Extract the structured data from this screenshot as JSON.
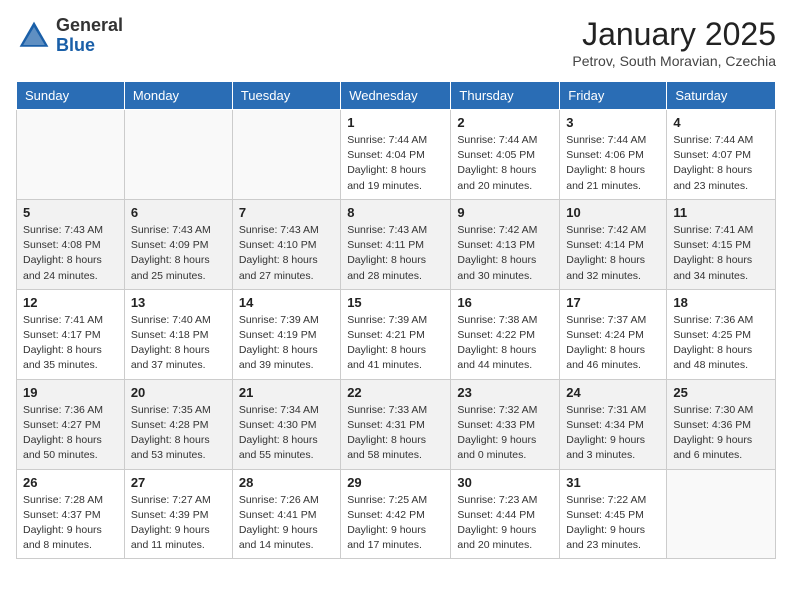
{
  "header": {
    "logo_general": "General",
    "logo_blue": "Blue",
    "month_year": "January 2025",
    "location": "Petrov, South Moravian, Czechia"
  },
  "days_of_week": [
    "Sunday",
    "Monday",
    "Tuesday",
    "Wednesday",
    "Thursday",
    "Friday",
    "Saturday"
  ],
  "weeks": [
    [
      {
        "day": "",
        "info": ""
      },
      {
        "day": "",
        "info": ""
      },
      {
        "day": "",
        "info": ""
      },
      {
        "day": "1",
        "info": "Sunrise: 7:44 AM\nSunset: 4:04 PM\nDaylight: 8 hours\nand 19 minutes."
      },
      {
        "day": "2",
        "info": "Sunrise: 7:44 AM\nSunset: 4:05 PM\nDaylight: 8 hours\nand 20 minutes."
      },
      {
        "day": "3",
        "info": "Sunrise: 7:44 AM\nSunset: 4:06 PM\nDaylight: 8 hours\nand 21 minutes."
      },
      {
        "day": "4",
        "info": "Sunrise: 7:44 AM\nSunset: 4:07 PM\nDaylight: 8 hours\nand 23 minutes."
      }
    ],
    [
      {
        "day": "5",
        "info": "Sunrise: 7:43 AM\nSunset: 4:08 PM\nDaylight: 8 hours\nand 24 minutes."
      },
      {
        "day": "6",
        "info": "Sunrise: 7:43 AM\nSunset: 4:09 PM\nDaylight: 8 hours\nand 25 minutes."
      },
      {
        "day": "7",
        "info": "Sunrise: 7:43 AM\nSunset: 4:10 PM\nDaylight: 8 hours\nand 27 minutes."
      },
      {
        "day": "8",
        "info": "Sunrise: 7:43 AM\nSunset: 4:11 PM\nDaylight: 8 hours\nand 28 minutes."
      },
      {
        "day": "9",
        "info": "Sunrise: 7:42 AM\nSunset: 4:13 PM\nDaylight: 8 hours\nand 30 minutes."
      },
      {
        "day": "10",
        "info": "Sunrise: 7:42 AM\nSunset: 4:14 PM\nDaylight: 8 hours\nand 32 minutes."
      },
      {
        "day": "11",
        "info": "Sunrise: 7:41 AM\nSunset: 4:15 PM\nDaylight: 8 hours\nand 34 minutes."
      }
    ],
    [
      {
        "day": "12",
        "info": "Sunrise: 7:41 AM\nSunset: 4:17 PM\nDaylight: 8 hours\nand 35 minutes."
      },
      {
        "day": "13",
        "info": "Sunrise: 7:40 AM\nSunset: 4:18 PM\nDaylight: 8 hours\nand 37 minutes."
      },
      {
        "day": "14",
        "info": "Sunrise: 7:39 AM\nSunset: 4:19 PM\nDaylight: 8 hours\nand 39 minutes."
      },
      {
        "day": "15",
        "info": "Sunrise: 7:39 AM\nSunset: 4:21 PM\nDaylight: 8 hours\nand 41 minutes."
      },
      {
        "day": "16",
        "info": "Sunrise: 7:38 AM\nSunset: 4:22 PM\nDaylight: 8 hours\nand 44 minutes."
      },
      {
        "day": "17",
        "info": "Sunrise: 7:37 AM\nSunset: 4:24 PM\nDaylight: 8 hours\nand 46 minutes."
      },
      {
        "day": "18",
        "info": "Sunrise: 7:36 AM\nSunset: 4:25 PM\nDaylight: 8 hours\nand 48 minutes."
      }
    ],
    [
      {
        "day": "19",
        "info": "Sunrise: 7:36 AM\nSunset: 4:27 PM\nDaylight: 8 hours\nand 50 minutes."
      },
      {
        "day": "20",
        "info": "Sunrise: 7:35 AM\nSunset: 4:28 PM\nDaylight: 8 hours\nand 53 minutes."
      },
      {
        "day": "21",
        "info": "Sunrise: 7:34 AM\nSunset: 4:30 PM\nDaylight: 8 hours\nand 55 minutes."
      },
      {
        "day": "22",
        "info": "Sunrise: 7:33 AM\nSunset: 4:31 PM\nDaylight: 8 hours\nand 58 minutes."
      },
      {
        "day": "23",
        "info": "Sunrise: 7:32 AM\nSunset: 4:33 PM\nDaylight: 9 hours\nand 0 minutes."
      },
      {
        "day": "24",
        "info": "Sunrise: 7:31 AM\nSunset: 4:34 PM\nDaylight: 9 hours\nand 3 minutes."
      },
      {
        "day": "25",
        "info": "Sunrise: 7:30 AM\nSunset: 4:36 PM\nDaylight: 9 hours\nand 6 minutes."
      }
    ],
    [
      {
        "day": "26",
        "info": "Sunrise: 7:28 AM\nSunset: 4:37 PM\nDaylight: 9 hours\nand 8 minutes."
      },
      {
        "day": "27",
        "info": "Sunrise: 7:27 AM\nSunset: 4:39 PM\nDaylight: 9 hours\nand 11 minutes."
      },
      {
        "day": "28",
        "info": "Sunrise: 7:26 AM\nSunset: 4:41 PM\nDaylight: 9 hours\nand 14 minutes."
      },
      {
        "day": "29",
        "info": "Sunrise: 7:25 AM\nSunset: 4:42 PM\nDaylight: 9 hours\nand 17 minutes."
      },
      {
        "day": "30",
        "info": "Sunrise: 7:23 AM\nSunset: 4:44 PM\nDaylight: 9 hours\nand 20 minutes."
      },
      {
        "day": "31",
        "info": "Sunrise: 7:22 AM\nSunset: 4:45 PM\nDaylight: 9 hours\nand 23 minutes."
      },
      {
        "day": "",
        "info": ""
      }
    ]
  ]
}
